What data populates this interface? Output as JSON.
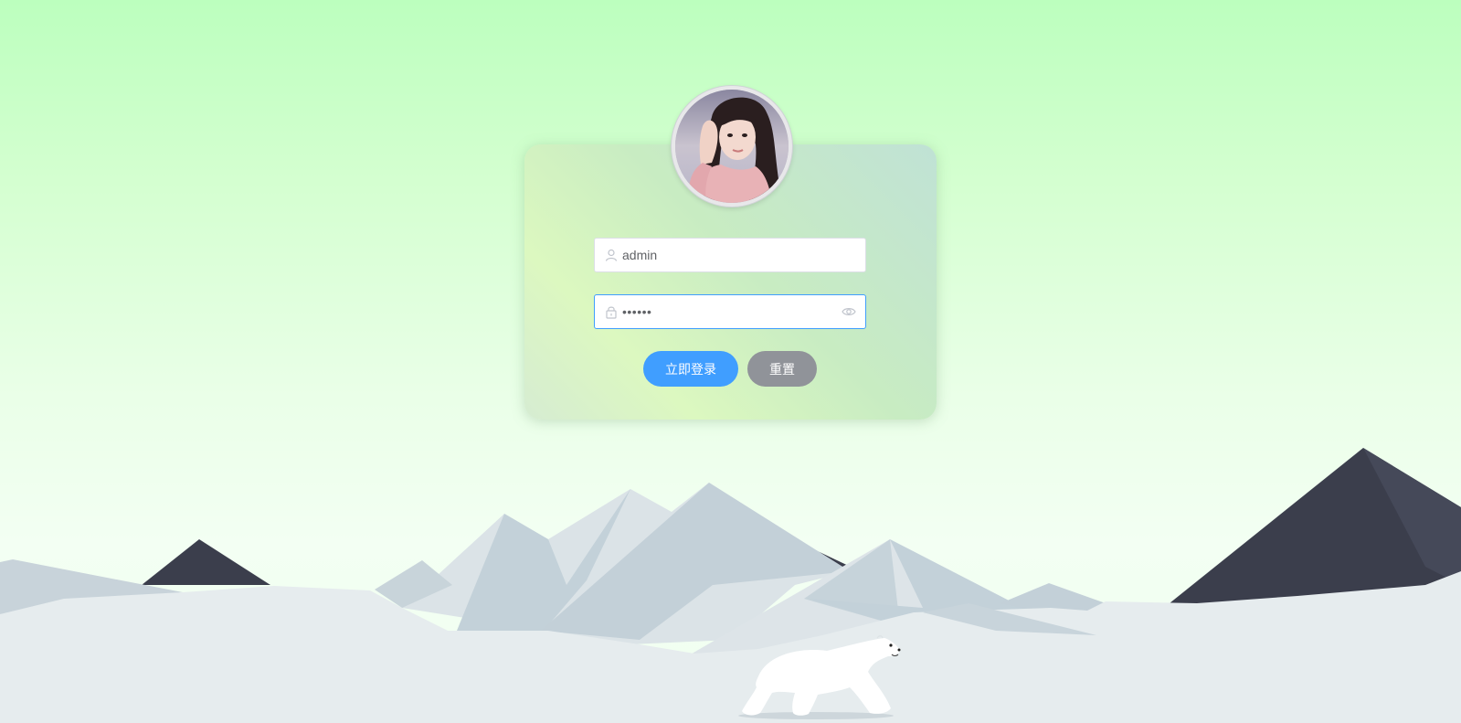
{
  "login_form": {
    "avatar_alt": "User avatar",
    "username": {
      "value": "admin",
      "icon": "user-icon"
    },
    "password": {
      "value": "••••••",
      "icon": "lock-icon",
      "toggle_icon": "eye-icon"
    },
    "login_button": "立即登录",
    "reset_button": "重置"
  },
  "colors": {
    "primary": "#409eff",
    "secondary": "#909399",
    "background_top": "#bcffbe",
    "mountain_dark": "#3b3e4c",
    "snow": "#e6ecee"
  }
}
